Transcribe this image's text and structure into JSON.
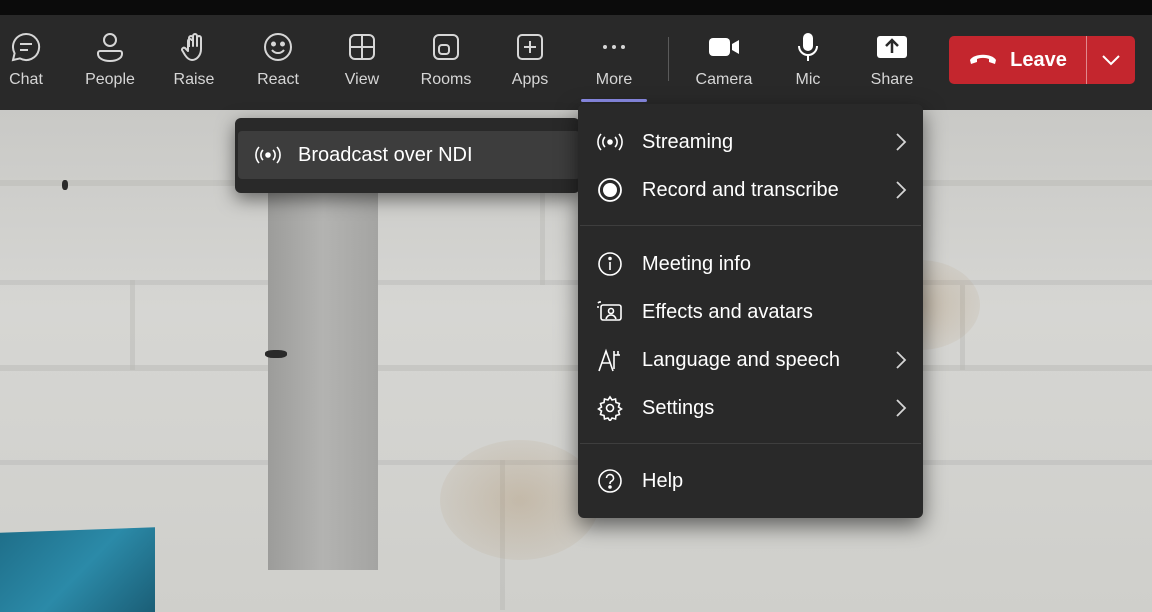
{
  "toolbar": {
    "items": [
      {
        "label": "Chat",
        "icon": "chat-icon"
      },
      {
        "label": "People",
        "icon": "people-icon"
      },
      {
        "label": "Raise",
        "icon": "hand-icon"
      },
      {
        "label": "React",
        "icon": "smiley-icon"
      },
      {
        "label": "View",
        "icon": "grid-icon"
      },
      {
        "label": "Rooms",
        "icon": "rooms-icon"
      },
      {
        "label": "Apps",
        "icon": "plus-square-icon"
      },
      {
        "label": "More",
        "icon": "ellipsis-icon"
      },
      {
        "label": "Camera",
        "icon": "camera-icon"
      },
      {
        "label": "Mic",
        "icon": "microphone-icon"
      },
      {
        "label": "Share",
        "icon": "share-tray-icon"
      }
    ],
    "active": "More",
    "leave_label": "Leave"
  },
  "flyout": {
    "item_label": "Broadcast over NDI",
    "icon": "broadcast-icon"
  },
  "more_menu": {
    "items": [
      {
        "label": "Streaming",
        "icon": "broadcast-icon",
        "has_submenu": true
      },
      {
        "label": "Record and transcribe",
        "icon": "record-icon",
        "has_submenu": true
      },
      {
        "label": "Meeting info",
        "icon": "info-icon",
        "has_submenu": false
      },
      {
        "label": "Effects and avatars",
        "icon": "effects-icon",
        "has_submenu": false
      },
      {
        "label": "Language and speech",
        "icon": "language-icon",
        "has_submenu": true
      },
      {
        "label": "Settings",
        "icon": "gear-icon",
        "has_submenu": true
      },
      {
        "label": "Help",
        "icon": "help-icon",
        "has_submenu": false
      }
    ]
  },
  "colors": {
    "toolbar_bg": "#292929",
    "menu_bg": "#292929",
    "leave_red": "#c4262e",
    "active_underline": "#8b8ce8"
  }
}
